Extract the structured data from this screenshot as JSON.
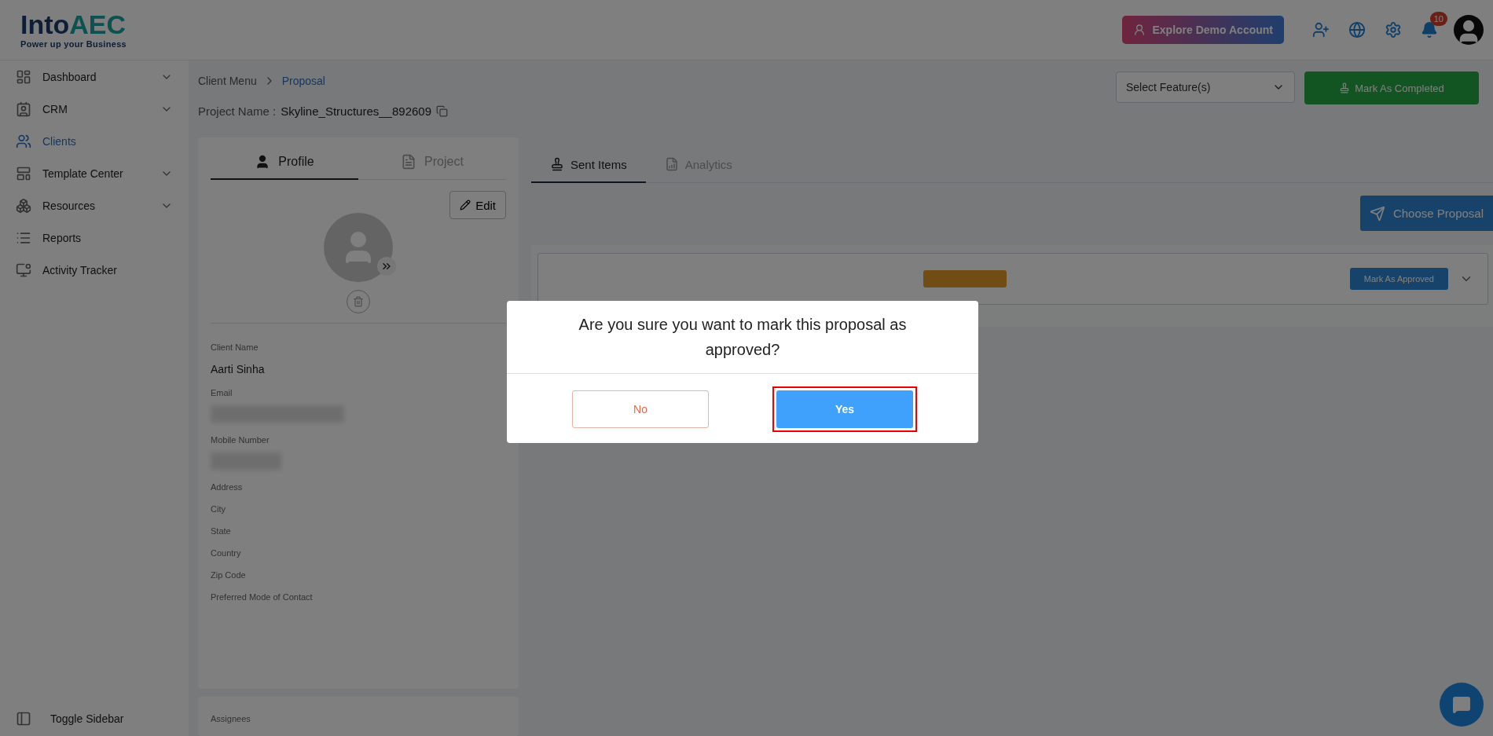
{
  "brand": {
    "name_a": "Into",
    "name_b": "AEC",
    "tagline": "Power up your Business"
  },
  "topbar": {
    "demo_button": "Explore Demo Account",
    "notification_count": "10"
  },
  "sidebar": {
    "items": [
      {
        "label": "Dashboard",
        "selected": false,
        "expandable": true
      },
      {
        "label": "CRM",
        "selected": false,
        "expandable": true
      },
      {
        "label": "Clients",
        "selected": true,
        "expandable": false
      },
      {
        "label": "Template Center",
        "selected": false,
        "expandable": true
      },
      {
        "label": "Resources",
        "selected": false,
        "expandable": true
      },
      {
        "label": "Reports",
        "selected": false,
        "expandable": false
      },
      {
        "label": "Activity Tracker",
        "selected": false,
        "expandable": false
      }
    ],
    "toggle": "Toggle Sidebar"
  },
  "breadcrumb": [
    {
      "label": "Client Menu",
      "current": false
    },
    {
      "label": "Proposal",
      "current": true
    }
  ],
  "project": {
    "label": "Project Name :",
    "value": "Skyline_Structures__892609"
  },
  "feature_select": {
    "placeholder": "Select Feature(s)"
  },
  "complete_button": "Mark As Completed",
  "profile_tabs": [
    {
      "label": "Profile",
      "selected": true
    },
    {
      "label": "Project",
      "selected": false
    }
  ],
  "edit_button": "Edit",
  "client_fields": [
    {
      "label": "Client Name",
      "kind": "value",
      "value": "Aarti Sinha"
    },
    {
      "label": "Email",
      "kind": "redacted"
    },
    {
      "label": "Mobile Number",
      "kind": "redacted"
    },
    {
      "label": "Address",
      "kind": "empty"
    },
    {
      "label": "City",
      "kind": "empty"
    },
    {
      "label": "State",
      "kind": "empty"
    },
    {
      "label": "Country",
      "kind": "empty"
    },
    {
      "label": "Zip Code",
      "kind": "empty"
    },
    {
      "label": "Preferred Mode of Contact",
      "kind": "empty"
    }
  ],
  "assignees": "Assignees",
  "main_tabs": [
    {
      "label": "Sent Items",
      "selected": true
    },
    {
      "label": "Analytics",
      "selected": false
    }
  ],
  "choose_button": "Choose Proposal",
  "proposal_row": {
    "approve_button": "Mark As Approved"
  },
  "dialog": {
    "message": "Are you sure you want to mark this proposal as approved?",
    "buttons": [
      {
        "label": "No",
        "kind": "cancel",
        "highlighted": false
      },
      {
        "label": "Yes",
        "kind": "confirm",
        "highlighted": true
      }
    ]
  }
}
